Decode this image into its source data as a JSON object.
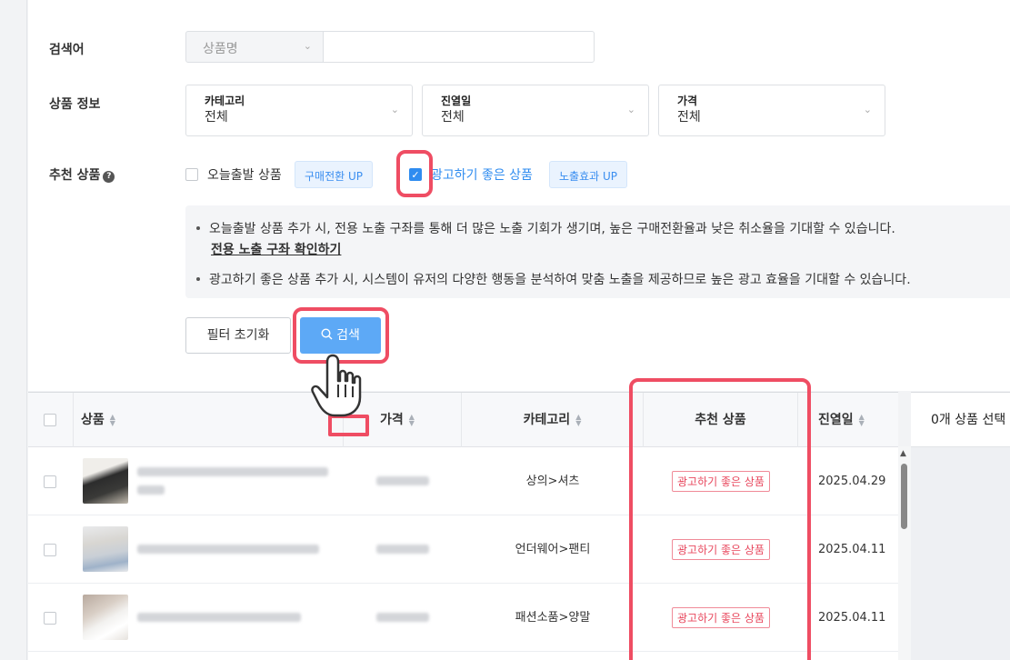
{
  "filter": {
    "keyword_label": "검색어",
    "keyword_type": "상품명",
    "keyword_value": "",
    "product_info_label": "상품 정보",
    "category": {
      "title": "카테고리",
      "value": "전체"
    },
    "display_date": {
      "title": "진열일",
      "value": "전체"
    },
    "price": {
      "title": "가격",
      "value": "전체"
    },
    "recommend_label": "추천 상품",
    "options": [
      {
        "label": "오늘출발 상품",
        "badge": "구매전환 UP",
        "checked": false
      },
      {
        "label": "광고하기 좋은 상품",
        "badge": "노출효과 UP",
        "checked": true
      }
    ],
    "notice": [
      "오늘출발 상품 추가 시, 전용 노출 구좌를 통해 더 많은 노출 기회가 생기며, 높은 구매전환율과 낮은 취소율을 기대할 수 있습니다.",
      "광고하기 좋은 상품 추가 시, 시스템이 유저의 다양한 행동을 분석하여 맞춤 노출을 제공하므로 높은 광고 효율을 기대할 수 있습니다."
    ],
    "notice_link": "전용 노출 구좌 확인하기",
    "reset_button": "필터 초기화",
    "search_button": "검색"
  },
  "table": {
    "headers": {
      "product": "상품",
      "price": "가격",
      "category": "카테고리",
      "recommend": "추천 상품",
      "date": "진열일"
    },
    "rows": [
      {
        "category": "상의>셔츠",
        "recommend": "광고하기 좋은 상품",
        "date": "2025.04.29"
      },
      {
        "category": "언더웨어>팬티",
        "recommend": "광고하기 좋은 상품",
        "date": "2025.04.11"
      },
      {
        "category": "패션소품>양말",
        "recommend": "광고하기 좋은 상품",
        "date": "2025.04.11"
      }
    ]
  },
  "selection_panel": {
    "header": "0개 상품 선택"
  },
  "colors": {
    "accent": "#2f8cf0",
    "highlight": "#ef4d63",
    "badge": "#e8485e",
    "search_button": "#5da9f6"
  },
  "icons": [
    "chevron-down-icon",
    "help-icon",
    "search-icon",
    "hand-pointer-icon",
    "sort-icon"
  ]
}
